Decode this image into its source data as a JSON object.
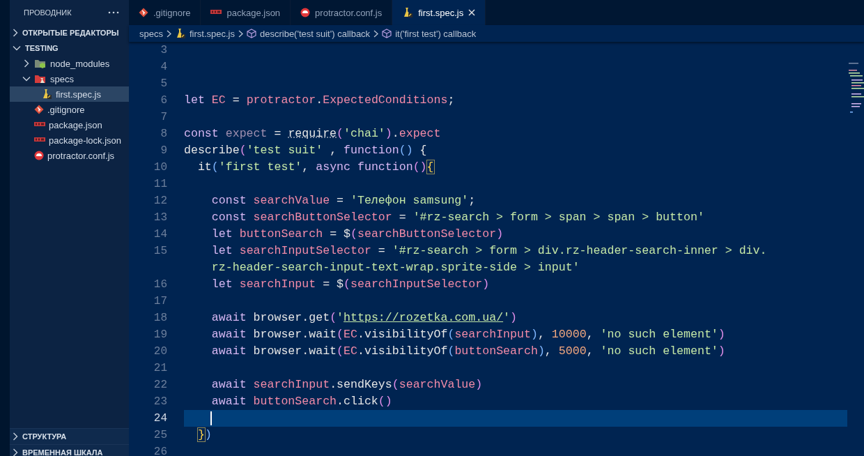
{
  "sidebar": {
    "title": "ПРОВОДНИК",
    "sections": [
      {
        "label": "ОТКРЫТЫЕ РЕДАКТОРЫ",
        "expanded": false
      },
      {
        "label": "TESTING",
        "expanded": true,
        "items": [
          {
            "label": "node_modules",
            "kind": "folder-node",
            "expanded": false,
            "selected": false
          },
          {
            "label": "specs",
            "kind": "folder-spec",
            "expanded": true,
            "selected": false,
            "children": [
              {
                "label": "first.spec.js",
                "kind": "test-js",
                "selected": true
              }
            ]
          },
          {
            "label": ".gitignore",
            "kind": "git",
            "selected": false
          },
          {
            "label": "package.json",
            "kind": "npm",
            "selected": false
          },
          {
            "label": "package-lock.json",
            "kind": "npm",
            "selected": false
          },
          {
            "label": "protractor.conf.js",
            "kind": "protractor",
            "selected": false
          }
        ]
      }
    ],
    "bottom_sections": [
      {
        "label": "СТРУКТУРА",
        "expanded": false
      },
      {
        "label": "ВРЕМЕННАЯ ШКАЛА",
        "expanded": false
      }
    ]
  },
  "tabs": [
    {
      "label": ".gitignore",
      "kind": "git",
      "selected": false
    },
    {
      "label": "package.json",
      "kind": "npm",
      "selected": false
    },
    {
      "label": "protractor.conf.js",
      "kind": "protractor",
      "selected": false
    },
    {
      "label": "first.spec.js",
      "kind": "test-js",
      "selected": true
    }
  ],
  "breadcrumbs": [
    {
      "label": "specs",
      "kind": "folder"
    },
    {
      "label": "first.spec.js",
      "kind": "test-js"
    },
    {
      "label": "describe('test suit') callback",
      "kind": "symbol"
    },
    {
      "label": "it('first test') callback",
      "kind": "symbol"
    }
  ],
  "lines": [
    {
      "number": "3",
      "current": false
    },
    {
      "number": "4",
      "current": false
    },
    {
      "number": "5",
      "current": false
    },
    {
      "number": "6",
      "current": false,
      "kind": "top",
      "tokens": [
        {
          "t": "let ",
          "kind": "kw"
        },
        {
          "t": "EC",
          "kind": "var"
        },
        {
          "t": " = ",
          "kind": "plain"
        },
        {
          "t": "protractor",
          "kind": "var"
        },
        {
          "t": ".",
          "kind": "plain"
        },
        {
          "t": "ExpectedConditions",
          "kind": "var"
        },
        {
          "t": ";",
          "kind": "plain"
        }
      ]
    },
    {
      "number": "7",
      "current": false
    },
    {
      "number": "8",
      "current": false,
      "kind": "top",
      "tokens": [
        {
          "t": "const ",
          "kind": "kw"
        },
        {
          "t": "expect",
          "kind": "dim"
        },
        {
          "t": " = ",
          "kind": "plain"
        },
        {
          "t": "require",
          "kind": "hint"
        },
        {
          "t": "(",
          "kind": "paren"
        },
        {
          "t": "'chai'",
          "kind": "str"
        },
        {
          "t": ")",
          "kind": "paren"
        },
        {
          "t": ".",
          "kind": "plain"
        },
        {
          "t": "expect",
          "kind": "var"
        }
      ]
    },
    {
      "number": "9",
      "current": false,
      "kind": "top",
      "tokens": [
        {
          "t": "describe",
          "kind": "plain"
        },
        {
          "t": "(",
          "kind": "paren"
        },
        {
          "t": "'test suit'",
          "kind": "str"
        },
        {
          "t": " , ",
          "kind": "plain"
        },
        {
          "t": "function",
          "kind": "kw"
        },
        {
          "t": "()",
          "kind": "paren2"
        },
        {
          "t": " {",
          "kind": "plain"
        }
      ]
    },
    {
      "number": "10",
      "current": false,
      "kind": "block",
      "tokens": [
        {
          "t": "it",
          "kind": "plain"
        },
        {
          "t": "(",
          "kind": "paren2"
        },
        {
          "t": "'first test'",
          "kind": "str"
        },
        {
          "t": ", ",
          "kind": "plain"
        },
        {
          "t": "async function",
          "kind": "kw"
        },
        {
          "t": "()",
          "kind": "paren"
        },
        {
          "t": "{",
          "kind": "match"
        }
      ]
    },
    {
      "number": "11",
      "current": false
    },
    {
      "number": "12",
      "current": false,
      "kind": "nested",
      "tokens": [
        {
          "t": "const ",
          "kind": "kw"
        },
        {
          "t": "searchValue",
          "kind": "var"
        },
        {
          "t": " = ",
          "kind": "plain"
        },
        {
          "t": "'Телефон samsung'",
          "kind": "str"
        },
        {
          "t": ";",
          "kind": "plain"
        }
      ]
    },
    {
      "number": "13",
      "current": false,
      "kind": "nested",
      "tokens": [
        {
          "t": "const ",
          "kind": "kw"
        },
        {
          "t": "searchButtonSelector",
          "kind": "var"
        },
        {
          "t": " = ",
          "kind": "plain"
        },
        {
          "t": "'#rz-search > form > span > span > button'",
          "kind": "str"
        }
      ]
    },
    {
      "number": "14",
      "current": false,
      "kind": "nested",
      "tokens": [
        {
          "t": "let ",
          "kind": "kw"
        },
        {
          "t": "buttonSearch",
          "kind": "var"
        },
        {
          "t": " = $",
          "kind": "plain"
        },
        {
          "t": "(",
          "kind": "paren"
        },
        {
          "t": "searchButtonSelector",
          "kind": "var"
        },
        {
          "t": ")",
          "kind": "paren"
        }
      ]
    },
    {
      "number": "15",
      "current": false,
      "kind": "nested",
      "tokens": [
        {
          "t": "let ",
          "kind": "kw"
        },
        {
          "t": "searchInputSelector",
          "kind": "var"
        },
        {
          "t": " = ",
          "kind": "plain"
        },
        {
          "t": "'#rz-search > form > div.rz-header-search-inner > div.",
          "kind": "str"
        }
      ],
      "wrap": [
        {
          "t": "rz-header-search-input-text-wrap.sprite-side > input'",
          "kind": "str"
        }
      ]
    },
    {
      "number": "16",
      "current": false,
      "kind": "nested",
      "tokens": [
        {
          "t": "let ",
          "kind": "kw"
        },
        {
          "t": "searchInput",
          "kind": "var"
        },
        {
          "t": " = $",
          "kind": "plain"
        },
        {
          "t": "(",
          "kind": "paren"
        },
        {
          "t": "searchInputSelector",
          "kind": "var"
        },
        {
          "t": ")",
          "kind": "paren"
        }
      ]
    },
    {
      "number": "17",
      "current": false
    },
    {
      "number": "18",
      "current": false,
      "kind": "nested",
      "tokens": [
        {
          "t": "await ",
          "kind": "kw"
        },
        {
          "t": "browser.get",
          "kind": "plain"
        },
        {
          "t": "(",
          "kind": "paren"
        },
        {
          "t": "'",
          "kind": "str"
        },
        {
          "t": "https://rozetka.com.ua/",
          "kind": "link"
        },
        {
          "t": "'",
          "kind": "str"
        },
        {
          "t": ")",
          "kind": "paren"
        }
      ]
    },
    {
      "number": "19",
      "current": false,
      "kind": "nested",
      "tokens": [
        {
          "t": "await ",
          "kind": "kw"
        },
        {
          "t": "browser.wait",
          "kind": "plain"
        },
        {
          "t": "(",
          "kind": "paren"
        },
        {
          "t": "EC",
          "kind": "var"
        },
        {
          "t": ".visibilityOf",
          "kind": "plain"
        },
        {
          "t": "(",
          "kind": "paren2"
        },
        {
          "t": "searchInput",
          "kind": "var"
        },
        {
          "t": ")",
          "kind": "paren2"
        },
        {
          "t": ", ",
          "kind": "plain"
        },
        {
          "t": "10000",
          "kind": "num"
        },
        {
          "t": ", ",
          "kind": "plain"
        },
        {
          "t": "'no such element'",
          "kind": "str"
        },
        {
          "t": ")",
          "kind": "paren"
        }
      ]
    },
    {
      "number": "20",
      "current": false,
      "kind": "nested",
      "tokens": [
        {
          "t": "await ",
          "kind": "kw"
        },
        {
          "t": "browser.wait",
          "kind": "plain"
        },
        {
          "t": "(",
          "kind": "paren"
        },
        {
          "t": "EC",
          "kind": "var"
        },
        {
          "t": ".visibilityOf",
          "kind": "plain"
        },
        {
          "t": "(",
          "kind": "paren2"
        },
        {
          "t": "buttonSearch",
          "kind": "var"
        },
        {
          "t": ")",
          "kind": "paren2"
        },
        {
          "t": ", ",
          "kind": "plain"
        },
        {
          "t": "5000",
          "kind": "num"
        },
        {
          "t": ", ",
          "kind": "plain"
        },
        {
          "t": "'no such element'",
          "kind": "str"
        },
        {
          "t": ")",
          "kind": "paren"
        }
      ]
    },
    {
      "number": "21",
      "current": false
    },
    {
      "number": "22",
      "current": false,
      "kind": "nested",
      "tokens": [
        {
          "t": "await ",
          "kind": "kw"
        },
        {
          "t": "searchInput",
          "kind": "var"
        },
        {
          "t": ".sendKeys",
          "kind": "plain"
        },
        {
          "t": "(",
          "kind": "paren"
        },
        {
          "t": "searchValue",
          "kind": "var"
        },
        {
          "t": ")",
          "kind": "paren"
        }
      ]
    },
    {
      "number": "23",
      "current": false,
      "kind": "nested",
      "tokens": [
        {
          "t": "await ",
          "kind": "kw"
        },
        {
          "t": "buttonSearch",
          "kind": "var"
        },
        {
          "t": ".click",
          "kind": "plain"
        },
        {
          "t": "()",
          "kind": "paren"
        }
      ]
    },
    {
      "number": "24",
      "current": true
    },
    {
      "number": "25",
      "current": false,
      "kind": "block",
      "tokens": [
        {
          "t": "}",
          "kind": "match"
        },
        {
          "t": ")",
          "kind": "paren2"
        }
      ]
    },
    {
      "number": "26",
      "current": false
    }
  ]
}
